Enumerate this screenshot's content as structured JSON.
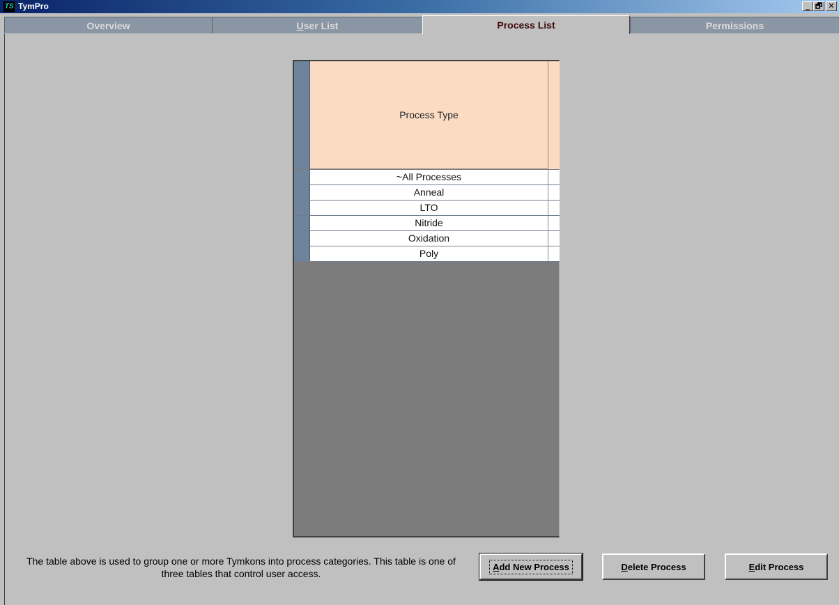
{
  "window": {
    "icon_text": "TS",
    "title": "TymPro",
    "minimize": "_",
    "restore": "🗗",
    "close": "✕"
  },
  "tabs": [
    {
      "label": "Overview"
    },
    {
      "label_underlined": "U",
      "label_rest": "ser List"
    },
    {
      "label": "Process List",
      "active": true
    },
    {
      "label": "Permissions"
    }
  ],
  "grid": {
    "column_header": "Process Type",
    "rows": [
      "~All Processes",
      "Anneal",
      "LTO",
      "Nitride",
      "Oxidation",
      "Poly"
    ]
  },
  "description": "The table above is used to group one or more Tymkons into process categories. This table is one of three tables that control user access.",
  "buttons": {
    "add": {
      "underline": "A",
      "rest": "dd New Process"
    },
    "delete": {
      "underline": "D",
      "rest": "elete Process"
    },
    "edit": {
      "underline": "E",
      "rest": "dit Process"
    }
  }
}
